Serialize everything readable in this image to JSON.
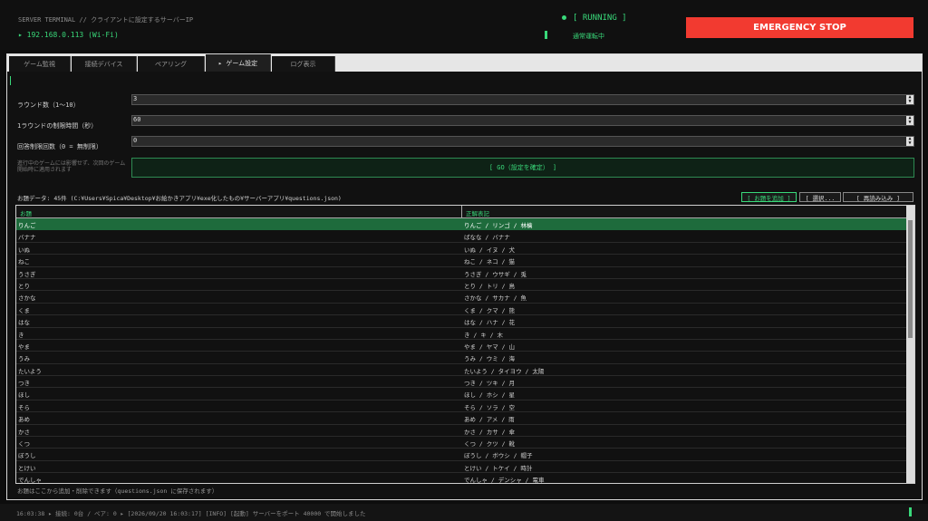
{
  "header": {
    "server_label": "SERVER TERMINAL // クライアントに設定するサーバーIP",
    "ip": "▸ 192.168.0.113 (Wi-Fi)",
    "status": "[ RUNNING ]",
    "status_sub": "通常運転中",
    "emergency_label": "EMERGENCY STOP",
    "accent": "#39d97a",
    "emergency_color": "#f23a30"
  },
  "tabs": [
    {
      "label": "ゲーム監視"
    },
    {
      "label": "接続デバイス"
    },
    {
      "label": "ペアリング"
    },
    {
      "label": "▸ ゲーム設定"
    },
    {
      "label": "ログ表示"
    }
  ],
  "settings": {
    "rounds_label": "ラウンド数（1〜10）",
    "rounds_value": "3",
    "time_label": "1ラウンドの制限時間（秒）",
    "time_value": "60",
    "answer_limit_label": "回答制限回数（0 = 無制限）",
    "answer_limit_value": "0",
    "note": "進行中のゲームには影響せず、次回のゲーム開始時に適用されます",
    "go_label": "[ GO（設定を確定） ]"
  },
  "questions": {
    "info": "お題データ: 45件 (C:¥Users¥Spica¥Desktop¥お絵かきアプリ¥exe化したもの¥サーバーアプリ¥questions.json)",
    "add_label": "[ お題を追加 ]",
    "select_label": "[ 選択...",
    "reload_label": "[ 再読み込み ]",
    "col_topic": "お題",
    "col_answer": "正解表記",
    "rows": [
      {
        "topic": "りんご",
        "answer": "りんご / リンゴ / 林檎"
      },
      {
        "topic": "バナナ",
        "answer": "ばなな / バナナ"
      },
      {
        "topic": "いぬ",
        "answer": "いぬ / イヌ / 犬"
      },
      {
        "topic": "ねこ",
        "answer": "ねこ / ネコ / 猫"
      },
      {
        "topic": "うさぎ",
        "answer": "うさぎ / ウサギ / 兎"
      },
      {
        "topic": "とり",
        "answer": "とり / トリ / 鳥"
      },
      {
        "topic": "さかな",
        "answer": "さかな / サカナ / 魚"
      },
      {
        "topic": "くま",
        "answer": "くま / クマ / 熊"
      },
      {
        "topic": "はな",
        "answer": "はな / ハナ / 花"
      },
      {
        "topic": "き",
        "answer": "き / キ / 木"
      },
      {
        "topic": "やま",
        "answer": "やま / ヤマ / 山"
      },
      {
        "topic": "うみ",
        "answer": "うみ / ウミ / 海"
      },
      {
        "topic": "たいよう",
        "answer": "たいよう / タイヨウ / 太陽"
      },
      {
        "topic": "つき",
        "answer": "つき / ツキ / 月"
      },
      {
        "topic": "ほし",
        "answer": "ほし / ホシ / 星"
      },
      {
        "topic": "そら",
        "answer": "そら / ソラ / 空"
      },
      {
        "topic": "あめ",
        "answer": "あめ / アメ / 雨"
      },
      {
        "topic": "かさ",
        "answer": "かさ / カサ / 傘"
      },
      {
        "topic": "くつ",
        "answer": "くつ / クツ / 靴"
      },
      {
        "topic": "ぼうし",
        "answer": "ぼうし / ボウシ / 帽子"
      },
      {
        "topic": "とけい",
        "answer": "とけい / トケイ / 時計"
      },
      {
        "topic": "でんしゃ",
        "answer": "でんしゃ / デンシャ / 電車"
      }
    ],
    "footnote": "お題はここから追加・削除できます（questions.json に保存されます）"
  },
  "status_bar": {
    "text": "16:03:38  ▸ 接続: 0台 / ペア: 0  ▸ [2026/09/20 16:03:17] [INFO] [起動] サーバーをポート 40000 で開始しました"
  }
}
